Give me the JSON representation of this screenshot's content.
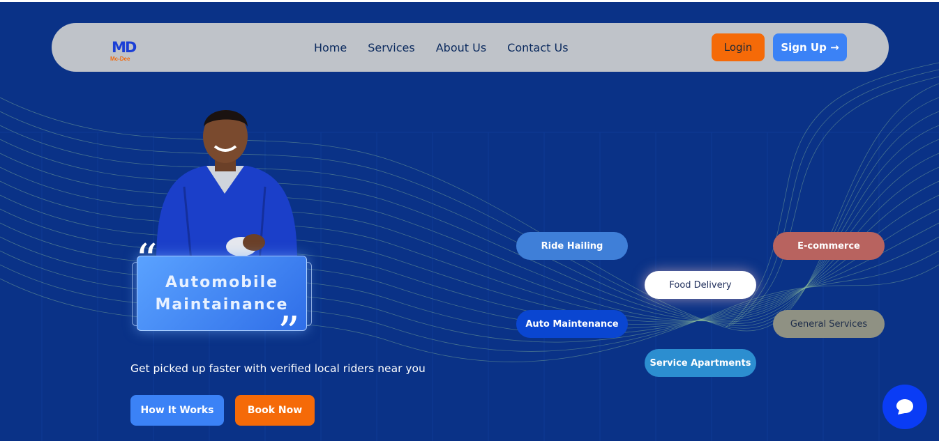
{
  "brand": {
    "logo_mark": "MD",
    "logo_sub": "Mc-Dee"
  },
  "nav": {
    "links": [
      "Home",
      "Services",
      "About Us",
      "Contact Us"
    ],
    "login_label": "Login",
    "signup_label": "Sign Up →"
  },
  "hero": {
    "quote_line1": "Automobile",
    "quote_line2": "Maintainance",
    "quote_open": "“",
    "quote_close": "”",
    "tagline": "Get picked up faster with verified local riders near you",
    "how_label": "How It Works",
    "book_label": "Book Now"
  },
  "services": [
    "Ride Hailing",
    "E-commerce",
    "Food Delivery",
    "Auto Maintenance",
    "General Services",
    "Service Apartments"
  ],
  "colors": {
    "background": "#0a3287",
    "nav_bg": "#bfc3c9",
    "accent_orange": "#f56a08",
    "accent_blue": "#3b82f6"
  },
  "icons": {
    "chat": "chat-bubble-icon"
  }
}
